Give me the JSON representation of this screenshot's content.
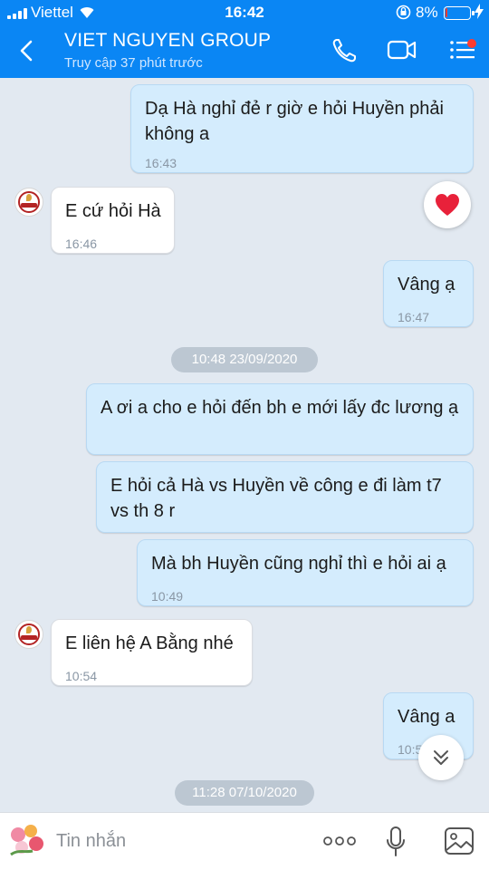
{
  "status": {
    "carrier": "Viettel",
    "time": "16:42",
    "battery_pct": "8%",
    "battery_level": 0.08
  },
  "header": {
    "title": "VIET NGUYEN GROUP",
    "subtitle": "Truy cập 37 phút trước"
  },
  "messages": [
    {
      "dir": "out",
      "text": "Dạ Hà nghỉ đẻ r giờ e hỏi Huyền phải không a",
      "time": "16:43"
    },
    {
      "dir": "in",
      "text": "E cứ hỏi Hà",
      "time": "16:46",
      "reaction": "heart-icon"
    },
    {
      "dir": "out",
      "text": "Vâng ạ",
      "time": "16:47"
    },
    {
      "type": "date",
      "text": "10:48 23/09/2020"
    },
    {
      "dir": "out",
      "text": "A ơi a cho e hỏi đến bh e mới lấy đc lương ạ"
    },
    {
      "dir": "out",
      "text": "E hỏi cả Hà vs Huyền về công e đi làm t7 vs th 8 r"
    },
    {
      "dir": "out",
      "text": "Mà bh Huyền cũng nghỉ thì e hỏi ai ạ",
      "time": "10:49"
    },
    {
      "dir": "in",
      "text": "E liên hệ A Bằng nhé",
      "time": "10:54"
    },
    {
      "dir": "out",
      "text": "Vâng a",
      "time": "10:5"
    },
    {
      "type": "date",
      "text": "11:28 07/10/2020"
    }
  ],
  "input": {
    "placeholder": "Tin nhắn"
  },
  "colors": {
    "header": "#0a86f4",
    "outgoing_bubble": "#d4ecfd",
    "incoming_bubble": "#ffffff",
    "background": "#e2e9f1"
  }
}
